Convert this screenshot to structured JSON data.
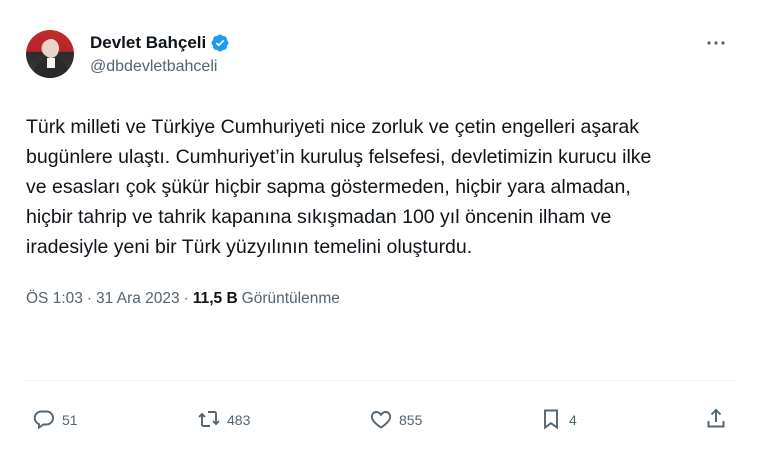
{
  "author": {
    "display_name": "Devlet Bahçeli",
    "handle": "@dbdevletbahceli"
  },
  "tweet": {
    "lines": [
      "Türk milleti ve Türkiye Cumhuriyeti nice zorluk ve çetin engelleri aşarak",
      "bugünlere ulaştı. Cumhuriyet’in kuruluş felsefesi, devletimizin kurucu ilke",
      "ve esasları çok şükür hiçbir sapma göstermeden, hiçbir yara almadan,",
      "hiçbir tahrip ve tahrik kapanına sıkışmadan 100 yıl öncenin ilham ve",
      "iradesiyle yeni bir Türk yüzyılının temelini oluşturdu."
    ]
  },
  "meta": {
    "time": "ÖS 1:03",
    "separator": "·",
    "date": "31 Ara 2023",
    "views_count": "11,5 B",
    "views_label": "Görüntülenme"
  },
  "actions": {
    "replies": "51",
    "retweets": "483",
    "likes": "855",
    "bookmarks": "4"
  },
  "icons": {
    "verified": "verified-badge-icon",
    "more": "more-options-icon",
    "reply": "reply-icon",
    "retweet": "retweet-icon",
    "like": "heart-icon",
    "bookmark": "bookmark-icon",
    "share": "share-icon"
  },
  "colors": {
    "verified_blue": "#1d9bf0",
    "text_primary": "#0f1419",
    "text_secondary": "#536471"
  }
}
